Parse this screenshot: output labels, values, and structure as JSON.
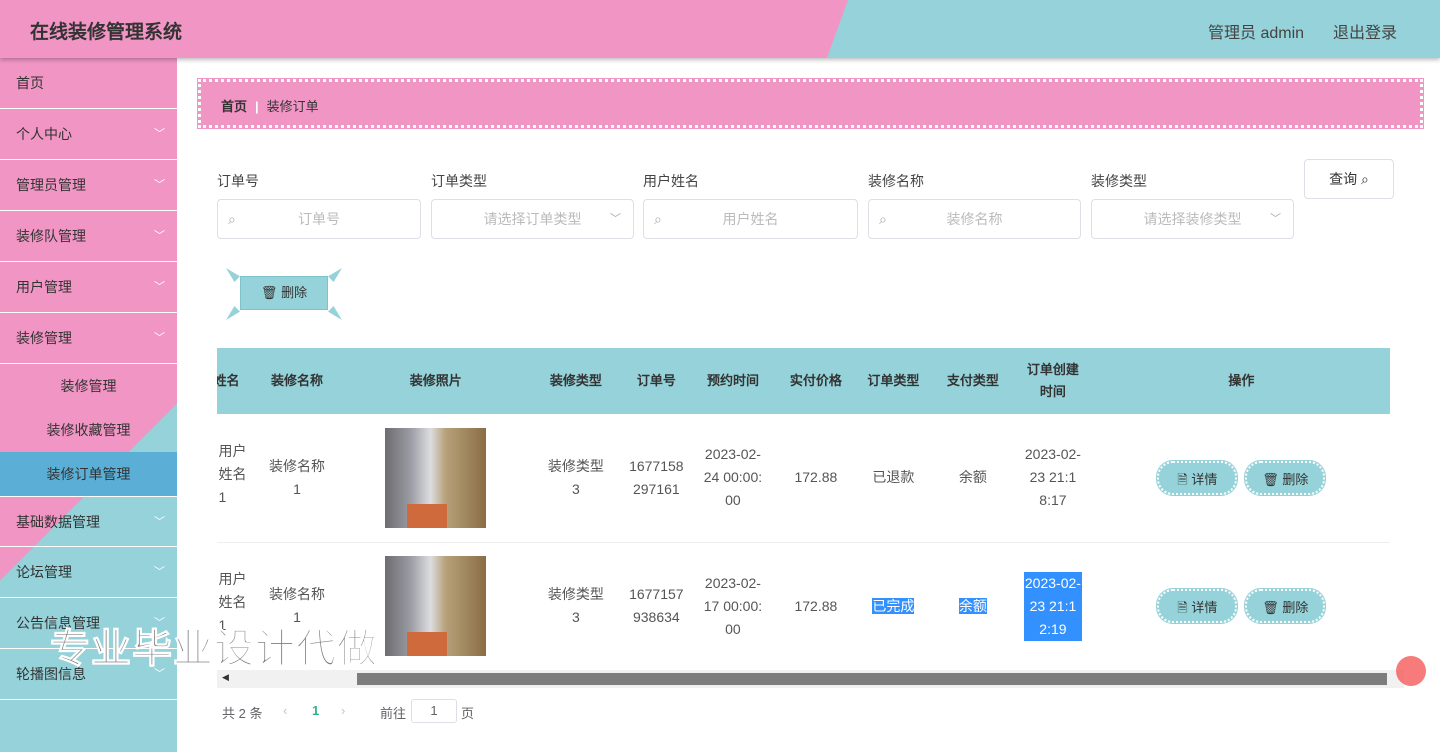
{
  "header": {
    "title": "在线装修管理系统",
    "user": "管理员 admin",
    "logout": "退出登录"
  },
  "sidebar": {
    "items": [
      {
        "label": "首页",
        "chev": false
      },
      {
        "label": "个人中心",
        "chev": true
      },
      {
        "label": "管理员管理",
        "chev": true
      },
      {
        "label": "装修队管理",
        "chev": true
      },
      {
        "label": "用户管理",
        "chev": true
      },
      {
        "label": "装修管理",
        "chev": true
      }
    ],
    "sub": [
      "装修管理",
      "装修收藏管理",
      "装修订单管理"
    ],
    "items2": [
      "基础数据管理",
      "论坛管理",
      "公告信息管理",
      "轮播图信息"
    ]
  },
  "breadcrumb": {
    "home": "首页",
    "current": "装修订单"
  },
  "search": {
    "fields": [
      {
        "label": "订单号",
        "placeholder": "订单号",
        "type": "input"
      },
      {
        "label": "订单类型",
        "placeholder": "请选择订单类型",
        "type": "select"
      },
      {
        "label": "用户姓名",
        "placeholder": "用户姓名",
        "type": "input"
      },
      {
        "label": "装修名称",
        "placeholder": "装修名称",
        "type": "input"
      },
      {
        "label": "装修类型",
        "placeholder": "请选择装修类型",
        "type": "select"
      }
    ],
    "query": "查询"
  },
  "delete_label": "删除",
  "table": {
    "columns": [
      "姓名",
      "装修名称",
      "装修照片",
      "装修类型",
      "订单号",
      "预约时间",
      "实付价格",
      "订单类型",
      "支付类型",
      "订单创建时间",
      "操作"
    ],
    "rows": [
      {
        "name": "用户姓名1",
        "deco": "装修名称1",
        "type": "装修类型3",
        "order": "1677158297161",
        "time": "2023-02-24 00:00:00",
        "price": "172.88",
        "otype": "已退款",
        "pay": "余额",
        "created": "2023-02-23 21:18:17"
      },
      {
        "name": "用户姓名1",
        "deco": "装修名称1",
        "type": "装修类型3",
        "order": "1677157938634",
        "time": "2023-02-17 00:00:00",
        "price": "172.88",
        "otype": "已完成",
        "pay": "余额",
        "created": "2023-02-23 21:12:19"
      }
    ],
    "detail": "详情",
    "delete": "删除"
  },
  "pager": {
    "total": "共 2 条",
    "page": "1",
    "goto": "前往",
    "goto_value": "1",
    "page_unit": "页"
  },
  "watermark": "专业毕业设计代做",
  "colors": {
    "pink": "#f095c4",
    "teal": "#95d2d9",
    "active": "#5bafd6"
  }
}
